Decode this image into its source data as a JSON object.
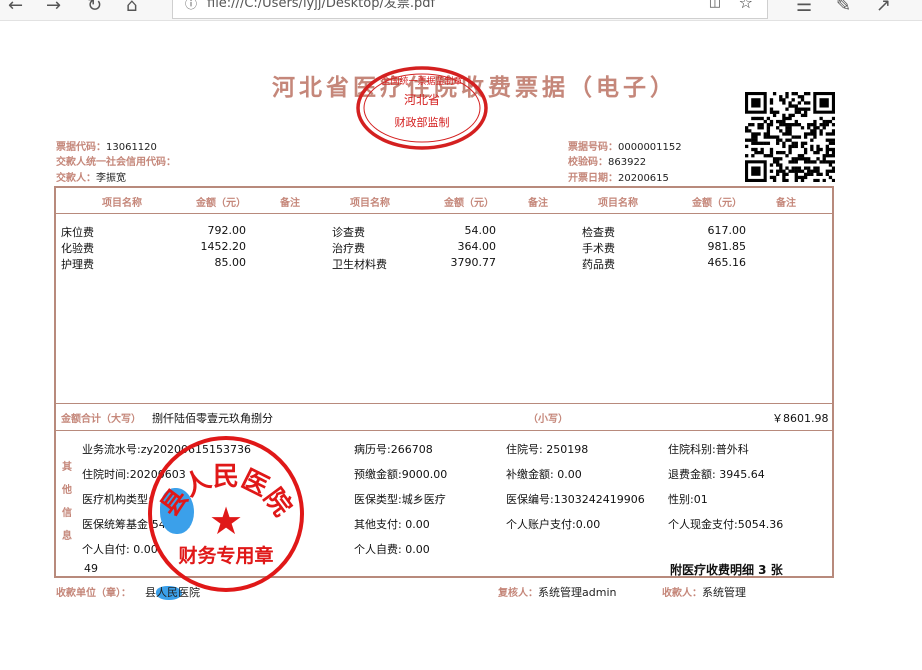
{
  "browser": {
    "url": "file:///C:/Users/lyjj/Desktop/发票.pdf",
    "icons": [
      "back-icon",
      "forward-icon",
      "refresh-icon",
      "home-icon",
      "info-icon",
      "reading-view-icon",
      "favorite-star-icon",
      "favorites-list-icon",
      "pen-icon",
      "share-icon"
    ]
  },
  "invoice": {
    "title": "河北省医疗住院收费票据（电子）",
    "stamp_top": {
      "line1": "全国统一票据监制章",
      "line2": "河北省",
      "line3": "财政部监制"
    },
    "left_meta": [
      {
        "label": "票据代码：",
        "value": "13061120"
      },
      {
        "label": "交款人统一社会信用代码：",
        "value": ""
      },
      {
        "label": "交款人：",
        "value": "李振宽"
      }
    ],
    "right_meta": [
      {
        "label": "票据号码：",
        "value": "0000001152"
      },
      {
        "label": "校验码：",
        "value": "863922"
      },
      {
        "label": "开票日期：",
        "value": "20200615"
      }
    ],
    "column_headers": {
      "name": "项目名称",
      "amount": "金额（元）",
      "note": "备注"
    },
    "items": [
      {
        "name": "床位费",
        "amount": "792.00"
      },
      {
        "name": "化验费",
        "amount": "1452.20"
      },
      {
        "name": "护理费",
        "amount": "85.00"
      },
      {
        "name": "诊查费",
        "amount": "54.00"
      },
      {
        "name": "治疗费",
        "amount": "364.00"
      },
      {
        "name": "卫生材料费",
        "amount": "3790.77"
      },
      {
        "name": "检查费",
        "amount": "617.00"
      },
      {
        "name": "手术费",
        "amount": "981.85"
      },
      {
        "name": "药品费",
        "amount": "465.16"
      }
    ],
    "total": {
      "label": "金额合计（大写）",
      "upper": "捌仟陆佰零壹元玖角捌分",
      "small_label": "（小写）",
      "small": "￥8601.98"
    },
    "other_label": "其他信息",
    "other_info": [
      "业务流水号:zy20200615153736",
      "病历号:266708",
      "住院号: 250198",
      "住院科别:普外科",
      "住院时间:20200603",
      "预缴金额:9000.00",
      "补缴金额: 0.00",
      "退费金额: 3945.64",
      "医疗机构类型:",
      "医保类型:城乡医疗",
      "医保编号:1303242419906",
      "性别:01",
      "医保统筹基金:547.62",
      "其他支付: 0.00",
      "个人账户支付:0.00",
      "个人现金支付:5054.36",
      "个人自付: 0.00",
      "个人自费: 0.00",
      "49"
    ],
    "attached": "附医疗收费明细 3 张",
    "footer": {
      "payee_unit_label": "收款单位（章）：",
      "payee_unit": "县人民医院",
      "reviewer_label": "复核人：",
      "reviewer": "系统管理admin",
      "collector_label": "收款人：",
      "collector": "系统管理"
    },
    "hospital_stamp": {
      "top_text": "县人民医院",
      "bottom_text": "财务专用章",
      "star": "★"
    }
  }
}
